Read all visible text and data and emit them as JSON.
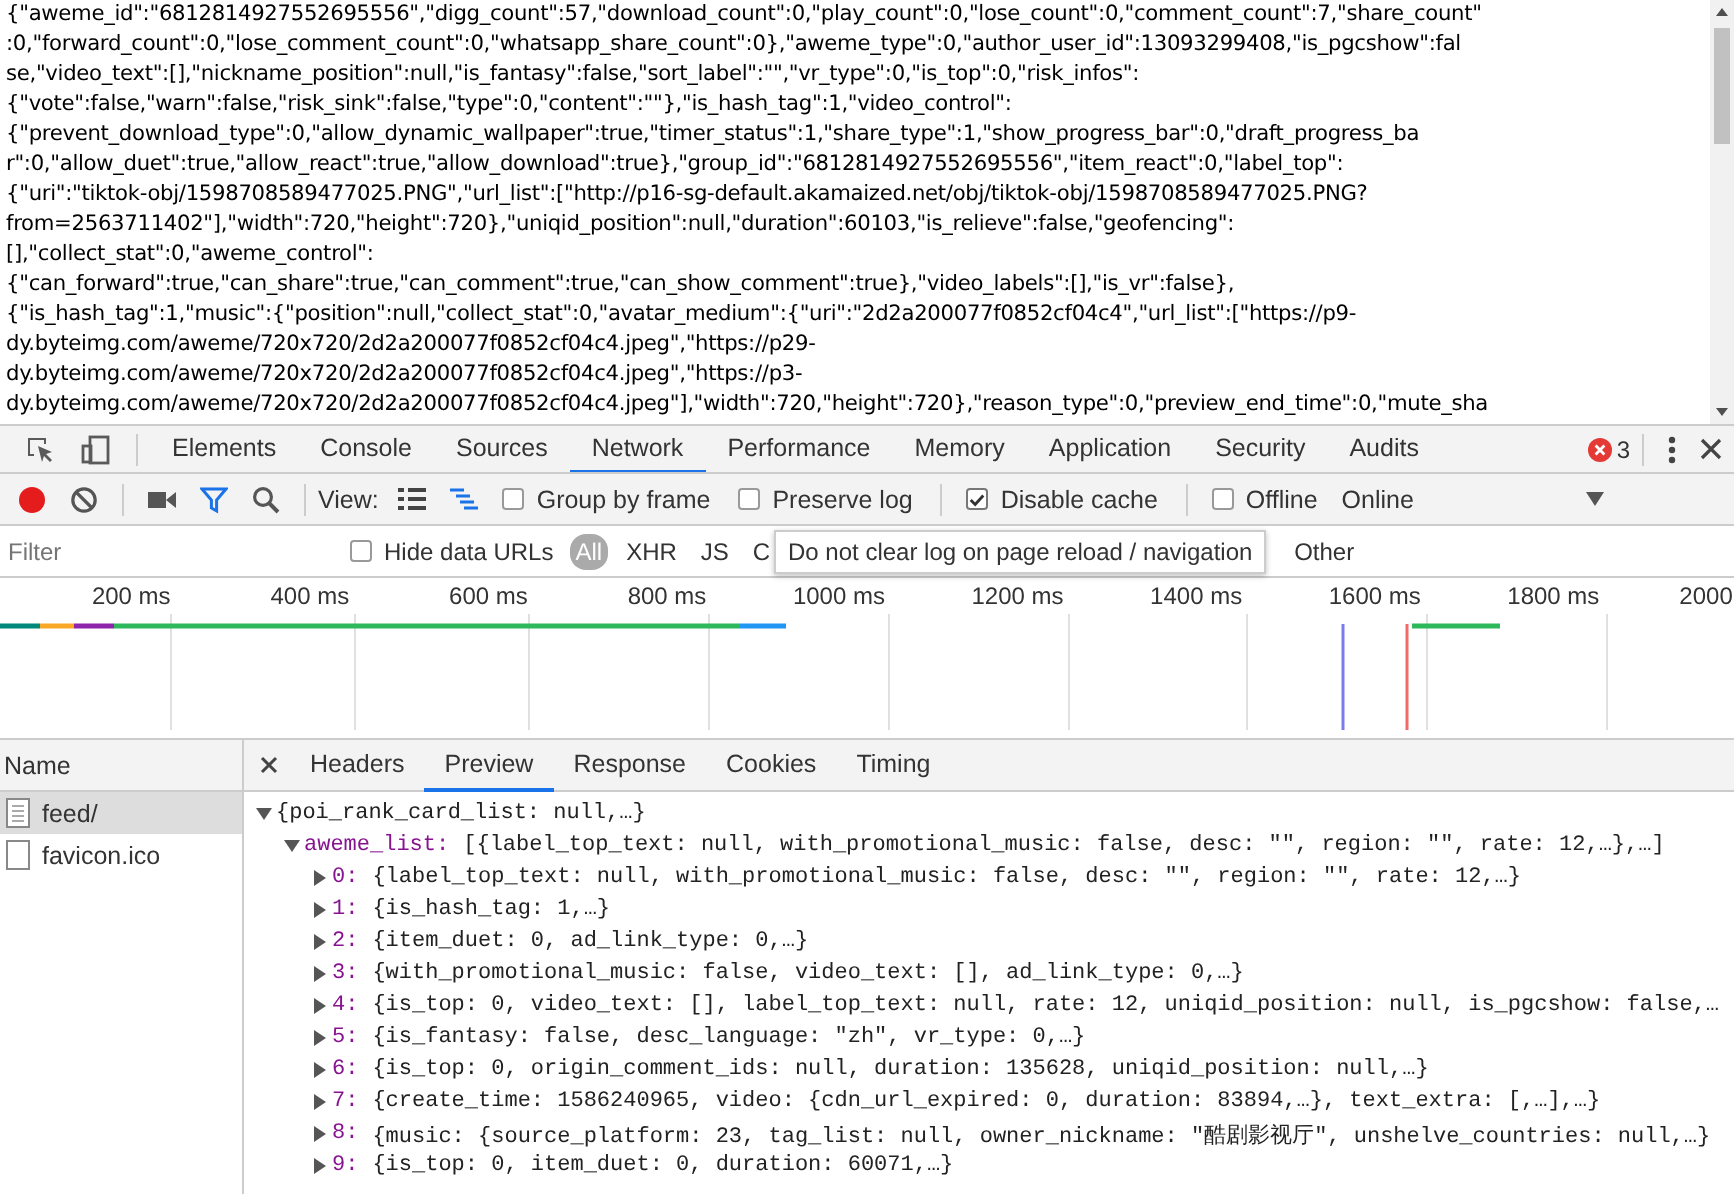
{
  "raw_response": {
    "lines": [
      "{\"aweme_id\":\"6812814927552695556\",\"digg_count\":57,\"download_count\":0,\"play_count\":0,\"lose_count\":0,\"comment_count\":7,\"share_count\"",
      ":0,\"forward_count\":0,\"lose_comment_count\":0,\"whatsapp_share_count\":0},\"aweme_type\":0,\"author_user_id\":13093299408,\"is_pgcshow\":fal",
      "se,\"video_text\":[],\"nickname_position\":null,\"is_fantasy\":false,\"sort_label\":\"\",\"vr_type\":0,\"is_top\":0,\"risk_infos\":",
      "{\"vote\":false,\"warn\":false,\"risk_sink\":false,\"type\":0,\"content\":\"\"},\"is_hash_tag\":1,\"video_control\":",
      "{\"prevent_download_type\":0,\"allow_dynamic_wallpaper\":true,\"timer_status\":1,\"share_type\":1,\"show_progress_bar\":0,\"draft_progress_ba",
      "r\":0,\"allow_duet\":true,\"allow_react\":true,\"allow_download\":true},\"group_id\":\"6812814927552695556\",\"item_react\":0,\"label_top\":",
      "{\"uri\":\"tiktok-obj/1598708589477025.PNG\",\"url_list\":[\"http://p16-sg-default.akamaized.net/obj/tiktok-obj/1598708589477025.PNG?",
      "from=2563711402\"],\"width\":720,\"height\":720},\"uniqid_position\":null,\"duration\":60103,\"is_relieve\":false,\"geofencing\":",
      "[],\"collect_stat\":0,\"aweme_control\":",
      "{\"can_forward\":true,\"can_share\":true,\"can_comment\":true,\"can_show_comment\":true},\"video_labels\":[],\"is_vr\":false},",
      "{\"is_hash_tag\":1,\"music\":{\"position\":null,\"collect_stat\":0,\"avatar_medium\":{\"uri\":\"2d2a200077f0852cf04c4\",\"url_list\":[\"https://p9-",
      "dy.byteimg.com/aweme/720x720/2d2a200077f0852cf04c4.jpeg\",\"https://p29-",
      "dy.byteimg.com/aweme/720x720/2d2a200077f0852cf04c4.jpeg\",\"https://p3-",
      "dy.byteimg.com/aweme/720x720/2d2a200077f0852cf04c4.jpeg\"],\"width\":720,\"height\":720},\"reason_type\":0,\"preview_end_time\":0,\"mute_sha"
    ]
  },
  "devtools": {
    "tabs": [
      {
        "label": "Elements",
        "selected": false
      },
      {
        "label": "Console",
        "selected": false
      },
      {
        "label": "Sources",
        "selected": false
      },
      {
        "label": "Network",
        "selected": true
      },
      {
        "label": "Performance",
        "selected": false
      },
      {
        "label": "Memory",
        "selected": false
      },
      {
        "label": "Application",
        "selected": false
      },
      {
        "label": "Security",
        "selected": false
      },
      {
        "label": "Audits",
        "selected": false
      }
    ],
    "error_count": "3",
    "toolbar": {
      "view_label": "View:",
      "checkboxes": [
        {
          "label": "Group by frame",
          "checked": false
        },
        {
          "label": "Preserve log",
          "checked": false
        },
        {
          "label": "Disable cache",
          "checked": true
        },
        {
          "label": "Offline",
          "checked": false
        }
      ],
      "throttling": "Online"
    },
    "filter": {
      "placeholder": "Filter",
      "hide_data_urls": {
        "label": "Hide data URLs",
        "checked": false
      },
      "types": [
        {
          "label": "All",
          "selected": true
        },
        {
          "label": "XHR",
          "selected": false
        },
        {
          "label": "JS",
          "selected": false
        },
        {
          "label": "C",
          "selected": false
        },
        {
          "label": "Other",
          "selected": false
        }
      ]
    },
    "tooltip": "Do not clear log on page reload / navigation",
    "timeline": {
      "ticks": [
        "200 ms",
        "400 ms",
        "600 ms",
        "800 ms",
        "1000 ms",
        "1200 ms",
        "1400 ms",
        "1600 ms",
        "1800 ms",
        "2000"
      ]
    },
    "requests": {
      "column": "Name",
      "items": [
        {
          "name": "feed/",
          "selected": true
        },
        {
          "name": "favicon.ico",
          "selected": false
        }
      ]
    },
    "detail_tabs": [
      {
        "label": "Headers",
        "selected": false
      },
      {
        "label": "Preview",
        "selected": true
      },
      {
        "label": "Response",
        "selected": false
      },
      {
        "label": "Cookies",
        "selected": false
      },
      {
        "label": "Timing",
        "selected": false
      }
    ],
    "preview": {
      "value": "{poi_rank_card_list: null,…}",
      "expanded": true,
      "children": [
        {
          "key": "aweme_list:",
          "value": "[{label_top_text: null, with_promotional_music: false, desc: \"\", region: \"\", rate: 12,…},…]",
          "expanded": true,
          "children": [
            {
              "key": "0:",
              "value": "{label_top_text: null, with_promotional_music: false, desc: \"\", region: \"\", rate: 12,…}",
              "expanded": false
            },
            {
              "key": "1:",
              "value": "{is_hash_tag: 1,…}",
              "expanded": false
            },
            {
              "key": "2:",
              "value": "{item_duet: 0, ad_link_type: 0,…}",
              "expanded": false
            },
            {
              "key": "3:",
              "value": "{with_promotional_music: false, video_text: [], ad_link_type: 0,…}",
              "expanded": false
            },
            {
              "key": "4:",
              "value": "{is_top: 0, video_text: [], label_top_text: null, rate: 12, uniqid_position: null, is_pgcshow: false,…",
              "expanded": false
            },
            {
              "key": "5:",
              "value": "{is_fantasy: false, desc_language: \"zh\", vr_type: 0,…}",
              "expanded": false
            },
            {
              "key": "6:",
              "value": "{is_top: 0, origin_comment_ids: null, duration: 135628, uniqid_position: null,…}",
              "expanded": false
            },
            {
              "key": "7:",
              "value": "{create_time: 1586240965, video: {cdn_url_expired: 0, duration: 83894,…}, text_extra: [,…],…}",
              "expanded": false
            },
            {
              "key": "8:",
              "value": "{music: {source_platform: 23, tag_list: null, owner_nickname: \"酷剧影视厅\", unshelve_countries: null,…}",
              "expanded": false
            },
            {
              "key": "9:",
              "value": "{is_top: 0, item_duet: 0, duration: 60071,…}",
              "expanded": false
            }
          ]
        }
      ]
    }
  }
}
